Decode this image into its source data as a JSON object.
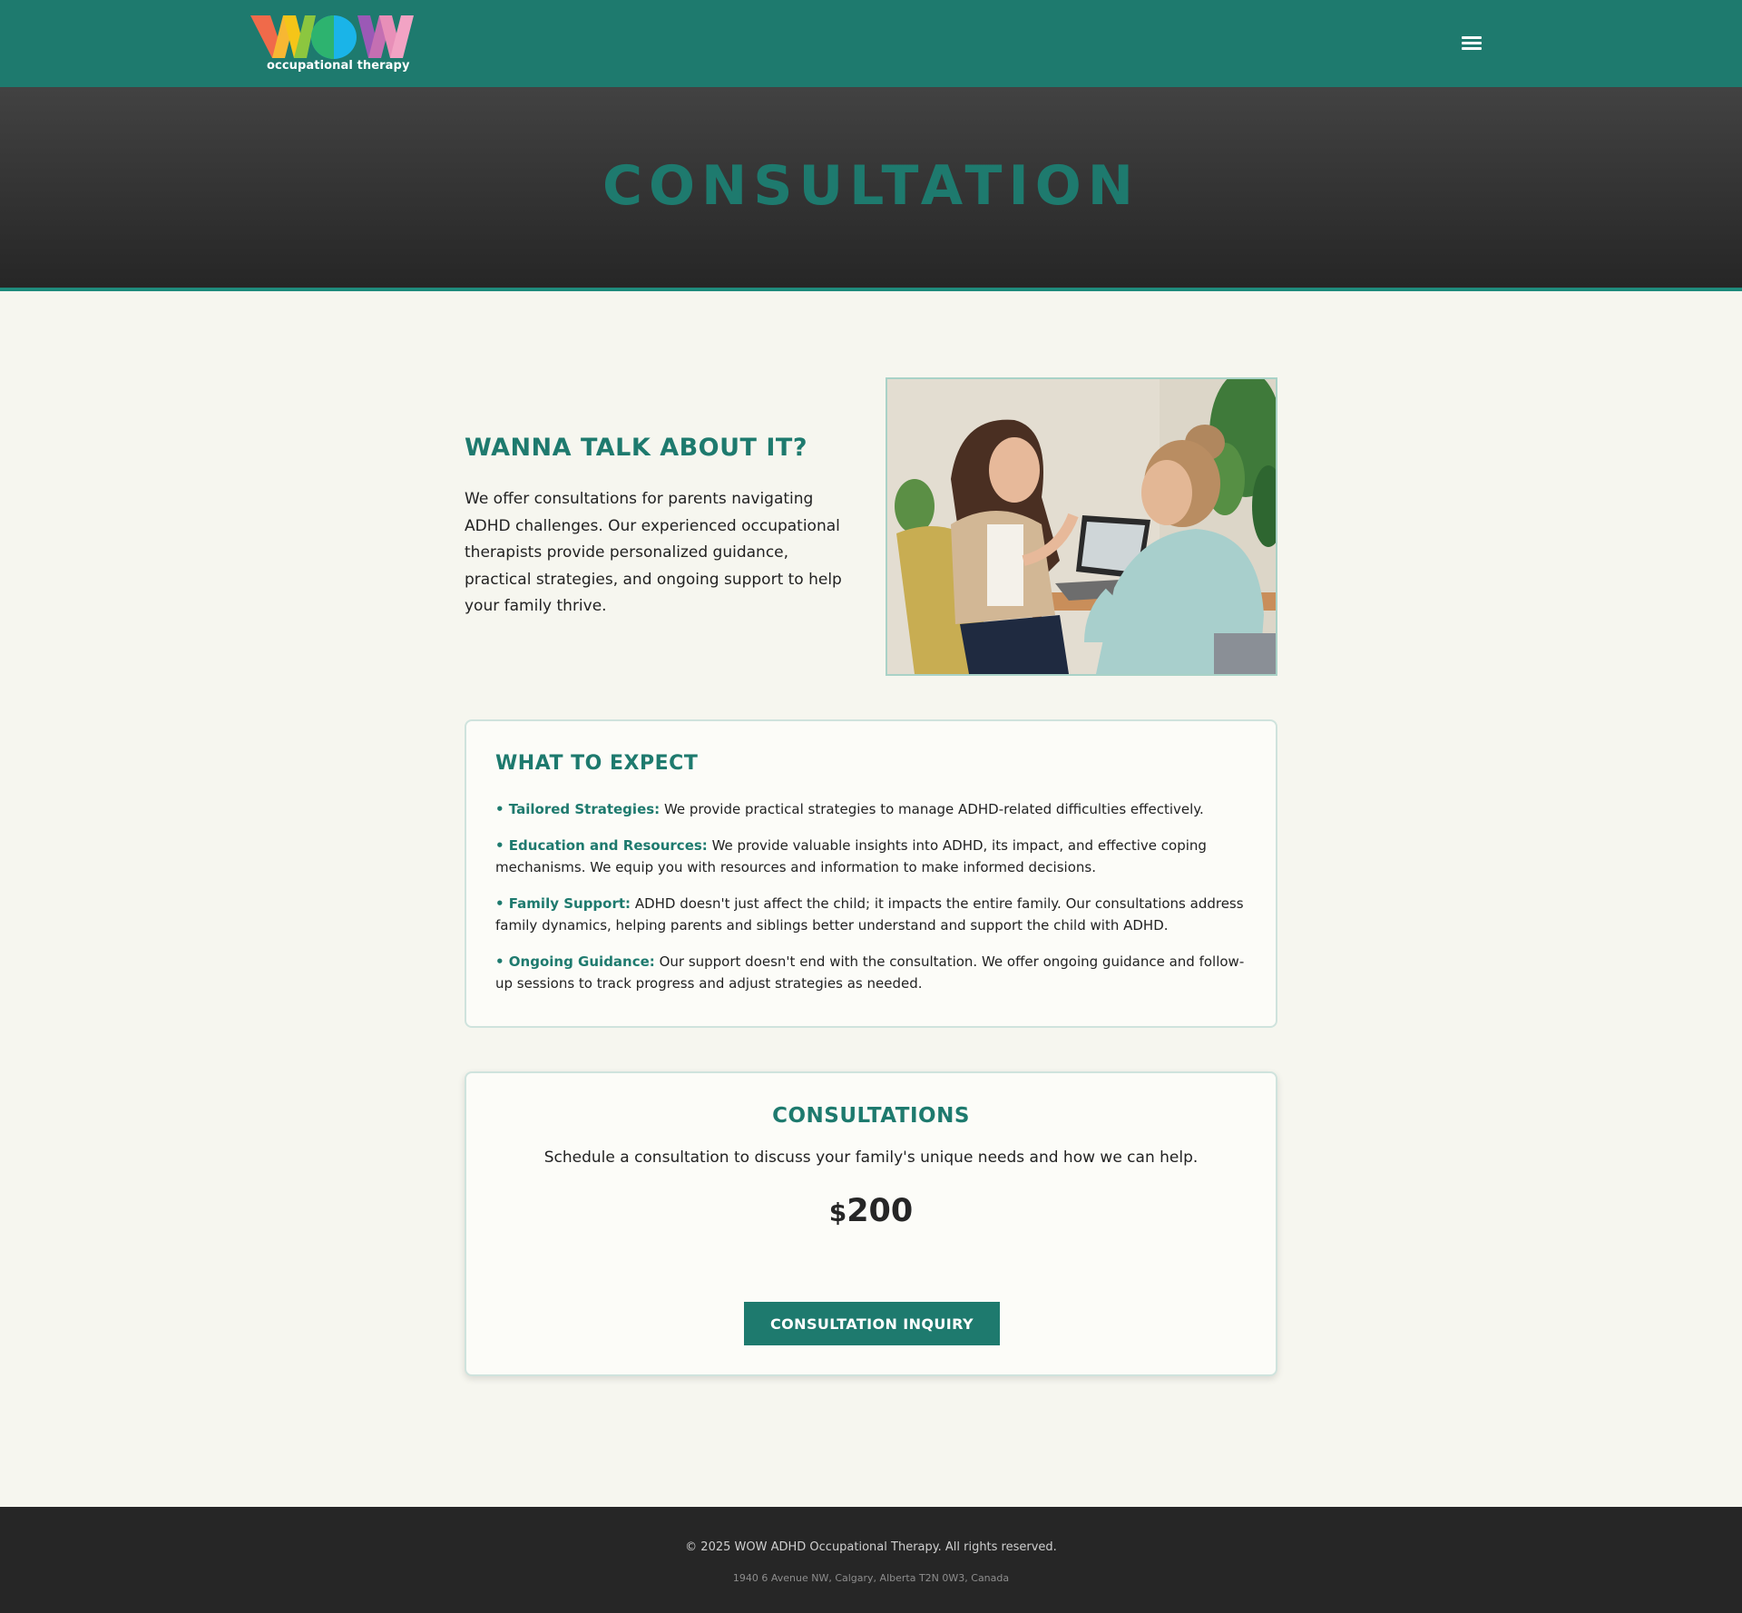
{
  "header": {
    "logo_text": "WOW",
    "logo_subtitle": "occupational therapy",
    "menu_icon": "hamburger-menu-icon"
  },
  "hero": {
    "title": "CONSULTATION"
  },
  "intro": {
    "heading": "WANNA TALK ABOUT IT?",
    "text": "We offer consultations for parents navigating ADHD challenges. Our experienced occupational therapists provide personalized guidance, practical strategies, and ongoing support to help your family thrive."
  },
  "expect": {
    "heading": "WHAT TO EXPECT",
    "items": [
      {
        "title": "• Tailored Strategies:",
        "text": " We provide practical strategies to manage ADHD-related difficulties effectively."
      },
      {
        "title": "• Education and Resources:",
        "text": " We provide valuable insights into ADHD, its impact, and effective coping mechanisms. We equip you with resources and information to make informed decisions."
      },
      {
        "title": "• Family Support:",
        "text": " ADHD doesn't just affect the child; it impacts the entire family. Our consultations address family dynamics, helping parents and siblings better understand and support the child with ADHD."
      },
      {
        "title": "• Ongoing Guidance:",
        "text": " Our support doesn't end with the consultation. We offer ongoing guidance and follow-up sessions to track progress and adjust strategies as needed."
      }
    ]
  },
  "consultations": {
    "heading": "CONSULTATIONS",
    "description": "Schedule a consultation to discuss your family's unique needs and how we can help.",
    "currency": "$",
    "price": "200",
    "button_label": "CONSULTATION INQUIRY"
  },
  "footer": {
    "copyright": "© 2025 WOW ADHD Occupational Therapy. All rights reserved.",
    "address": "1940 6 Avenue NW, Calgary, Alberta T2N 0W3, Canada"
  },
  "colors": {
    "brand_teal": "#1e7a6e",
    "hero_dark": "#333333",
    "page_bg": "#f6f6ef",
    "footer_bg": "#262626"
  }
}
